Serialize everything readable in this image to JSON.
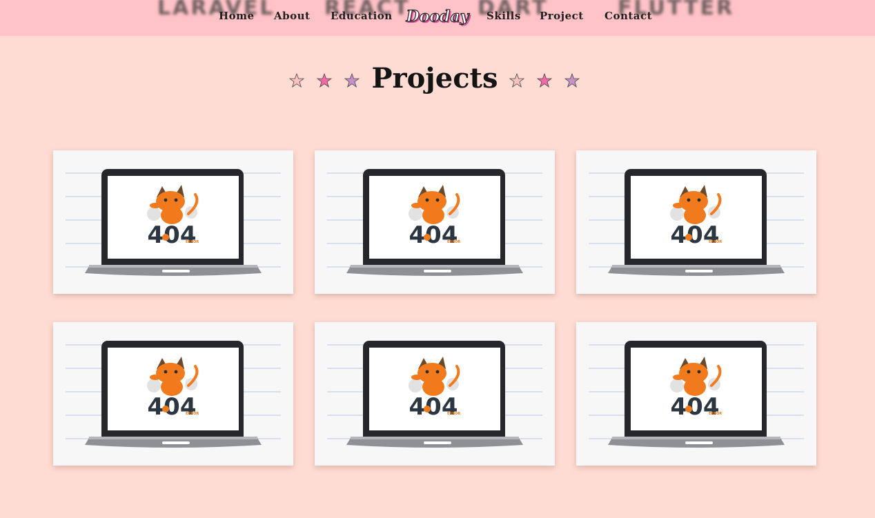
{
  "nav": {
    "background_words": [
      "LARAVEL",
      "REACT",
      "DART",
      "FLUTTER"
    ],
    "links": [
      "Home",
      "About",
      "Education",
      "Skills",
      "Project",
      "Contact"
    ],
    "logo_text": "Dooday"
  },
  "section": {
    "title": "Projects",
    "star_colors": [
      "#f8c2c0",
      "#f06aa8",
      "#c890c9"
    ]
  },
  "projects": [
    {
      "image_text": "404",
      "image_subtext": "ERROR"
    },
    {
      "image_text": "404",
      "image_subtext": "ERROR"
    },
    {
      "image_text": "404",
      "image_subtext": "ERROR"
    },
    {
      "image_text": "404",
      "image_subtext": "ERROR"
    },
    {
      "image_text": "404",
      "image_subtext": "ERROR"
    },
    {
      "image_text": "404",
      "image_subtext": "ERROR"
    }
  ],
  "colors": {
    "page_bg": "#ffdcd3",
    "nav_bg": "#ffc2c7",
    "cat_orange": "#f07a1c",
    "error_text": "#2b3640"
  }
}
